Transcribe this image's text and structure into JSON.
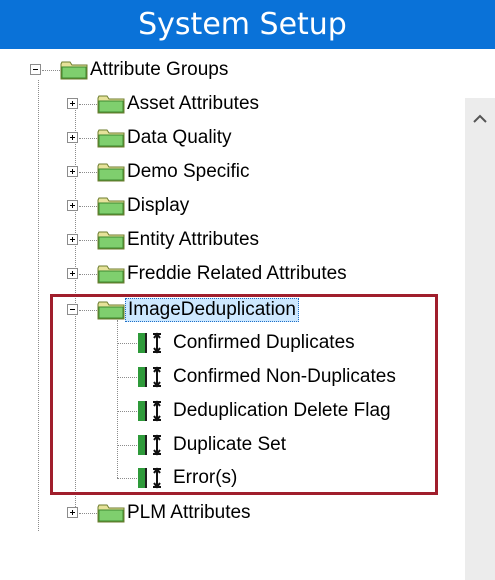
{
  "window": {
    "title": "System Setup"
  },
  "tree": {
    "root": {
      "label": "Attribute Groups",
      "expanded": true
    },
    "groups": [
      {
        "label": "Asset Attributes",
        "expanded": false
      },
      {
        "label": "Data Quality",
        "expanded": false
      },
      {
        "label": "Demo Specific",
        "expanded": false
      },
      {
        "label": "Display",
        "expanded": false
      },
      {
        "label": "Entity Attributes",
        "expanded": false
      },
      {
        "label": "Freddie Related Attributes",
        "expanded": false
      },
      {
        "label": "ImageDeduplication",
        "expanded": true,
        "selected": true
      },
      {
        "label": "PLM Attributes",
        "expanded": false
      }
    ],
    "image_dedup_children": [
      {
        "label": "Confirmed Duplicates"
      },
      {
        "label": "Confirmed Non-Duplicates"
      },
      {
        "label": "Deduplication Delete Flag"
      },
      {
        "label": "Duplicate Set"
      },
      {
        "label": "Error(s)"
      }
    ]
  },
  "icons": {
    "folder": "folder-icon",
    "attribute": "attribute-icon",
    "scroll_up": "chevron-up-icon"
  },
  "colors": {
    "title_bar": "#0a72d8",
    "highlight_box": "#a01e2c",
    "selection": "#cde8ff"
  }
}
